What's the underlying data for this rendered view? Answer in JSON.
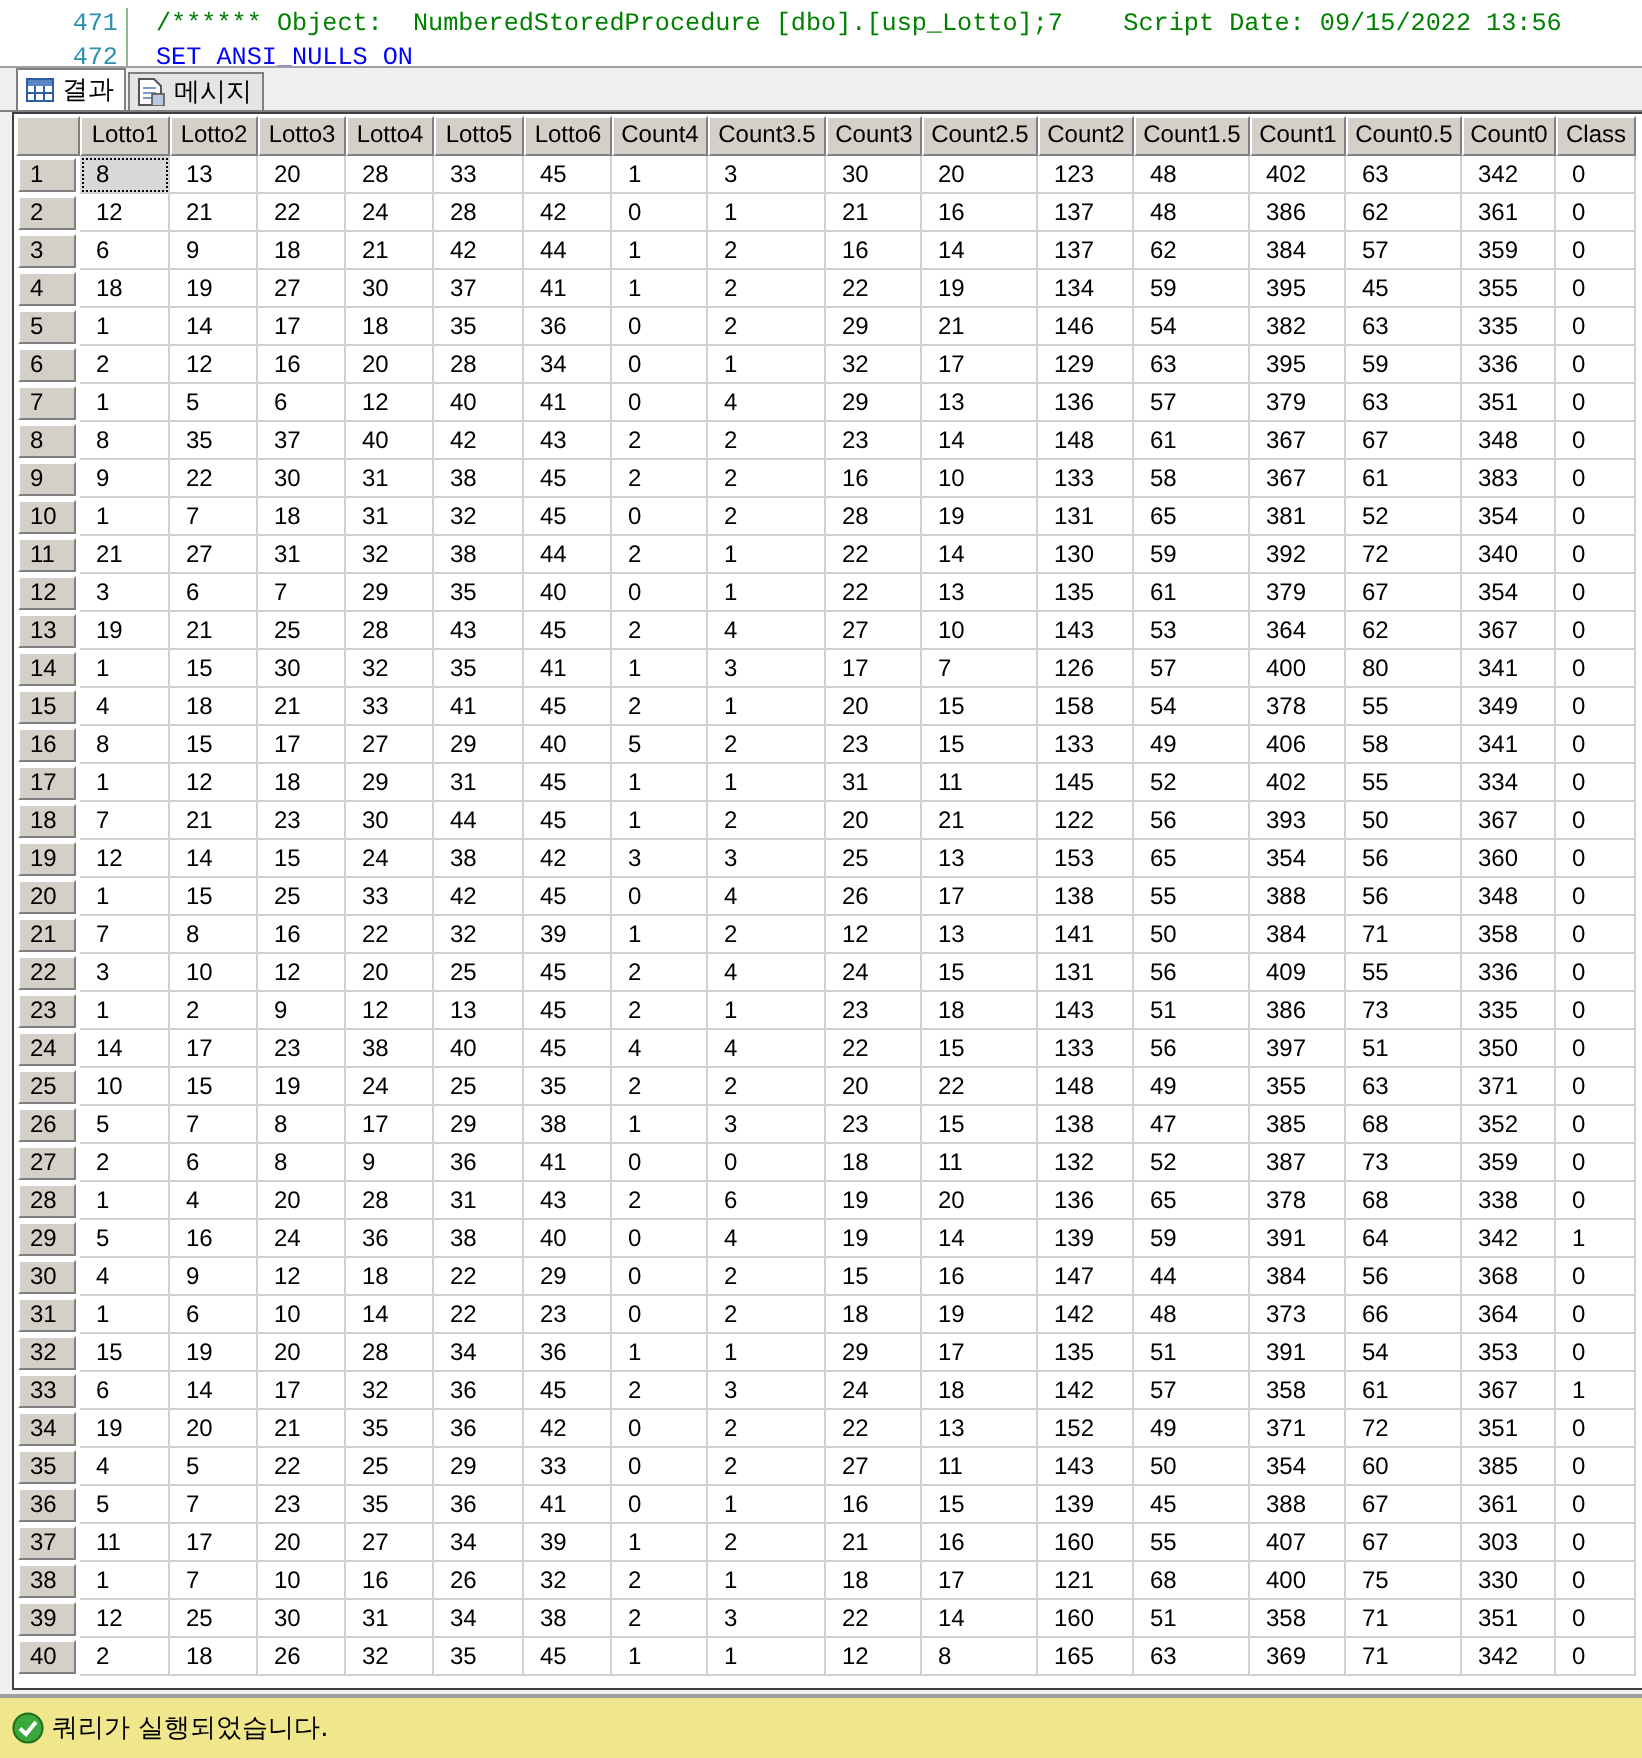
{
  "editor": {
    "lines": [
      {
        "number": "471",
        "code": "/****** Object:  NumberedStoredProcedure [dbo].[usp_Lotto];7    Script Date: 09/15/2022 13:56"
      },
      {
        "number": "472",
        "code": "SET ANSI_NULLS ON"
      }
    ]
  },
  "tabs": [
    {
      "label": "결과",
      "selected": true
    },
    {
      "label": "메시지",
      "selected": false
    }
  ],
  "table": {
    "columns": [
      "Lotto1",
      "Lotto2",
      "Lotto3",
      "Lotto4",
      "Lotto5",
      "Lotto6",
      "Count4",
      "Count3.5",
      "Count3",
      "Count2.5",
      "Count2",
      "Count1.5",
      "Count1",
      "Count0.5",
      "Count0",
      "Class"
    ],
    "rows": [
      {
        "number": "1",
        "active": true,
        "cells": [
          "8",
          "13",
          "20",
          "28",
          "33",
          "45",
          "1",
          "3",
          "30",
          "20",
          "123",
          "48",
          "402",
          "63",
          "342",
          "0"
        ]
      },
      {
        "number": "2",
        "active": false,
        "cells": [
          "12",
          "21",
          "22",
          "24",
          "28",
          "42",
          "0",
          "1",
          "21",
          "16",
          "137",
          "48",
          "386",
          "62",
          "361",
          "0"
        ]
      },
      {
        "number": "3",
        "active": false,
        "cells": [
          "6",
          "9",
          "18",
          "21",
          "42",
          "44",
          "1",
          "2",
          "16",
          "14",
          "137",
          "62",
          "384",
          "57",
          "359",
          "0"
        ]
      },
      {
        "number": "4",
        "active": false,
        "cells": [
          "18",
          "19",
          "27",
          "30",
          "37",
          "41",
          "1",
          "2",
          "22",
          "19",
          "134",
          "59",
          "395",
          "45",
          "355",
          "0"
        ]
      },
      {
        "number": "5",
        "active": false,
        "cells": [
          "1",
          "14",
          "17",
          "18",
          "35",
          "36",
          "0",
          "2",
          "29",
          "21",
          "146",
          "54",
          "382",
          "63",
          "335",
          "0"
        ]
      },
      {
        "number": "6",
        "active": false,
        "cells": [
          "2",
          "12",
          "16",
          "20",
          "28",
          "34",
          "0",
          "1",
          "32",
          "17",
          "129",
          "63",
          "395",
          "59",
          "336",
          "0"
        ]
      },
      {
        "number": "7",
        "active": false,
        "cells": [
          "1",
          "5",
          "6",
          "12",
          "40",
          "41",
          "0",
          "4",
          "29",
          "13",
          "136",
          "57",
          "379",
          "63",
          "351",
          "0"
        ]
      },
      {
        "number": "8",
        "active": false,
        "cells": [
          "8",
          "35",
          "37",
          "40",
          "42",
          "43",
          "2",
          "2",
          "23",
          "14",
          "148",
          "61",
          "367",
          "67",
          "348",
          "0"
        ]
      },
      {
        "number": "9",
        "active": false,
        "cells": [
          "9",
          "22",
          "30",
          "31",
          "38",
          "45",
          "2",
          "2",
          "16",
          "10",
          "133",
          "58",
          "367",
          "61",
          "383",
          "0"
        ]
      },
      {
        "number": "10",
        "active": false,
        "cells": [
          "1",
          "7",
          "18",
          "31",
          "32",
          "45",
          "0",
          "2",
          "28",
          "19",
          "131",
          "65",
          "381",
          "52",
          "354",
          "0"
        ]
      },
      {
        "number": "11",
        "active": false,
        "cells": [
          "21",
          "27",
          "31",
          "32",
          "38",
          "44",
          "2",
          "1",
          "22",
          "14",
          "130",
          "59",
          "392",
          "72",
          "340",
          "0"
        ]
      },
      {
        "number": "12",
        "active": false,
        "cells": [
          "3",
          "6",
          "7",
          "29",
          "35",
          "40",
          "0",
          "1",
          "22",
          "13",
          "135",
          "61",
          "379",
          "67",
          "354",
          "0"
        ]
      },
      {
        "number": "13",
        "active": false,
        "cells": [
          "19",
          "21",
          "25",
          "28",
          "43",
          "45",
          "2",
          "4",
          "27",
          "10",
          "143",
          "53",
          "364",
          "62",
          "367",
          "0"
        ]
      },
      {
        "number": "14",
        "active": false,
        "cells": [
          "1",
          "15",
          "30",
          "32",
          "35",
          "41",
          "1",
          "3",
          "17",
          "7",
          "126",
          "57",
          "400",
          "80",
          "341",
          "0"
        ]
      },
      {
        "number": "15",
        "active": false,
        "cells": [
          "4",
          "18",
          "21",
          "33",
          "41",
          "45",
          "2",
          "1",
          "20",
          "15",
          "158",
          "54",
          "378",
          "55",
          "349",
          "0"
        ]
      },
      {
        "number": "16",
        "active": false,
        "cells": [
          "8",
          "15",
          "17",
          "27",
          "29",
          "40",
          "5",
          "2",
          "23",
          "15",
          "133",
          "49",
          "406",
          "58",
          "341",
          "0"
        ]
      },
      {
        "number": "17",
        "active": false,
        "cells": [
          "1",
          "12",
          "18",
          "29",
          "31",
          "45",
          "1",
          "1",
          "31",
          "11",
          "145",
          "52",
          "402",
          "55",
          "334",
          "0"
        ]
      },
      {
        "number": "18",
        "active": false,
        "cells": [
          "7",
          "21",
          "23",
          "30",
          "44",
          "45",
          "1",
          "2",
          "20",
          "21",
          "122",
          "56",
          "393",
          "50",
          "367",
          "0"
        ]
      },
      {
        "number": "19",
        "active": false,
        "cells": [
          "12",
          "14",
          "15",
          "24",
          "38",
          "42",
          "3",
          "3",
          "25",
          "13",
          "153",
          "65",
          "354",
          "56",
          "360",
          "0"
        ]
      },
      {
        "number": "20",
        "active": false,
        "cells": [
          "1",
          "15",
          "25",
          "33",
          "42",
          "45",
          "0",
          "4",
          "26",
          "17",
          "138",
          "55",
          "388",
          "56",
          "348",
          "0"
        ]
      },
      {
        "number": "21",
        "active": false,
        "cells": [
          "7",
          "8",
          "16",
          "22",
          "32",
          "39",
          "1",
          "2",
          "12",
          "13",
          "141",
          "50",
          "384",
          "71",
          "358",
          "0"
        ]
      },
      {
        "number": "22",
        "active": false,
        "cells": [
          "3",
          "10",
          "12",
          "20",
          "25",
          "45",
          "2",
          "4",
          "24",
          "15",
          "131",
          "56",
          "409",
          "55",
          "336",
          "0"
        ]
      },
      {
        "number": "23",
        "active": false,
        "cells": [
          "1",
          "2",
          "9",
          "12",
          "13",
          "45",
          "2",
          "1",
          "23",
          "18",
          "143",
          "51",
          "386",
          "73",
          "335",
          "0"
        ]
      },
      {
        "number": "24",
        "active": false,
        "cells": [
          "14",
          "17",
          "23",
          "38",
          "40",
          "45",
          "4",
          "4",
          "22",
          "15",
          "133",
          "56",
          "397",
          "51",
          "350",
          "0"
        ]
      },
      {
        "number": "25",
        "active": false,
        "cells": [
          "10",
          "15",
          "19",
          "24",
          "25",
          "35",
          "2",
          "2",
          "20",
          "22",
          "148",
          "49",
          "355",
          "63",
          "371",
          "0"
        ]
      },
      {
        "number": "26",
        "active": false,
        "cells": [
          "5",
          "7",
          "8",
          "17",
          "29",
          "38",
          "1",
          "3",
          "23",
          "15",
          "138",
          "47",
          "385",
          "68",
          "352",
          "0"
        ]
      },
      {
        "number": "27",
        "active": false,
        "cells": [
          "2",
          "6",
          "8",
          "9",
          "36",
          "41",
          "0",
          "0",
          "18",
          "11",
          "132",
          "52",
          "387",
          "73",
          "359",
          "0"
        ]
      },
      {
        "number": "28",
        "active": false,
        "cells": [
          "1",
          "4",
          "20",
          "28",
          "31",
          "43",
          "2",
          "6",
          "19",
          "20",
          "136",
          "65",
          "378",
          "68",
          "338",
          "0"
        ]
      },
      {
        "number": "29",
        "active": false,
        "cells": [
          "5",
          "16",
          "24",
          "36",
          "38",
          "40",
          "0",
          "4",
          "19",
          "14",
          "139",
          "59",
          "391",
          "64",
          "342",
          "1"
        ]
      },
      {
        "number": "30",
        "active": false,
        "cells": [
          "4",
          "9",
          "12",
          "18",
          "22",
          "29",
          "0",
          "2",
          "15",
          "16",
          "147",
          "44",
          "384",
          "56",
          "368",
          "0"
        ]
      },
      {
        "number": "31",
        "active": false,
        "cells": [
          "1",
          "6",
          "10",
          "14",
          "22",
          "23",
          "0",
          "2",
          "18",
          "19",
          "142",
          "48",
          "373",
          "66",
          "364",
          "0"
        ]
      },
      {
        "number": "32",
        "active": false,
        "cells": [
          "15",
          "19",
          "20",
          "28",
          "34",
          "36",
          "1",
          "1",
          "29",
          "17",
          "135",
          "51",
          "391",
          "54",
          "353",
          "0"
        ]
      },
      {
        "number": "33",
        "active": false,
        "cells": [
          "6",
          "14",
          "17",
          "32",
          "36",
          "45",
          "2",
          "3",
          "24",
          "18",
          "142",
          "57",
          "358",
          "61",
          "367",
          "1"
        ]
      },
      {
        "number": "34",
        "active": false,
        "cells": [
          "19",
          "20",
          "21",
          "35",
          "36",
          "42",
          "0",
          "2",
          "22",
          "13",
          "152",
          "49",
          "371",
          "72",
          "351",
          "0"
        ]
      },
      {
        "number": "35",
        "active": false,
        "cells": [
          "4",
          "5",
          "22",
          "25",
          "29",
          "33",
          "0",
          "2",
          "27",
          "11",
          "143",
          "50",
          "354",
          "60",
          "385",
          "0"
        ]
      },
      {
        "number": "36",
        "active": false,
        "cells": [
          "5",
          "7",
          "23",
          "35",
          "36",
          "41",
          "0",
          "1",
          "16",
          "15",
          "139",
          "45",
          "388",
          "67",
          "361",
          "0"
        ]
      },
      {
        "number": "37",
        "active": false,
        "cells": [
          "11",
          "17",
          "20",
          "27",
          "34",
          "39",
          "1",
          "2",
          "21",
          "16",
          "160",
          "55",
          "407",
          "67",
          "303",
          "0"
        ]
      },
      {
        "number": "38",
        "active": false,
        "cells": [
          "1",
          "7",
          "10",
          "16",
          "26",
          "32",
          "2",
          "1",
          "18",
          "17",
          "121",
          "68",
          "400",
          "75",
          "330",
          "0"
        ]
      },
      {
        "number": "39",
        "active": false,
        "cells": [
          "12",
          "25",
          "30",
          "31",
          "34",
          "38",
          "2",
          "3",
          "22",
          "14",
          "160",
          "51",
          "358",
          "71",
          "351",
          "0"
        ]
      },
      {
        "number": "40",
        "active": false,
        "cells": [
          "2",
          "18",
          "26",
          "32",
          "35",
          "45",
          "1",
          "1",
          "12",
          "8",
          "165",
          "63",
          "369",
          "71",
          "342",
          "0"
        ]
      }
    ]
  },
  "status_bar": {
    "message": "쿼리가 실행되었습니다.",
    "kind": "success"
  }
}
